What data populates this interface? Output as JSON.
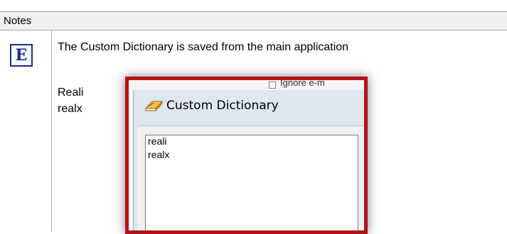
{
  "notes": {
    "header_label": "Notes",
    "icon_letter": "E",
    "message": "The Custom Dictionary is saved from the main application",
    "words": [
      "Reali",
      "realx"
    ]
  },
  "background": {
    "checkbox_label": "Ignore e-m"
  },
  "dialog": {
    "title": "Custom Dictionary",
    "entries": [
      "reali",
      "realx"
    ],
    "highlight_color": "#b3121a"
  }
}
